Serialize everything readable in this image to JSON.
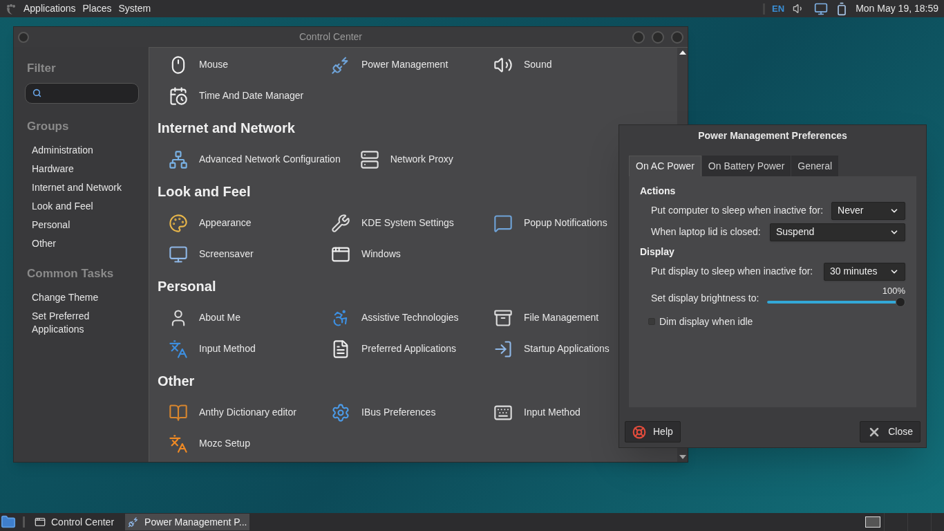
{
  "top_panel": {
    "menus": [
      "Applications",
      "Places",
      "System"
    ],
    "keyboard_layout": "EN",
    "clock": "Mon May 19, 18:59"
  },
  "control_center": {
    "title": "Control Center",
    "filter_heading": "Filter",
    "groups_heading": "Groups",
    "groups": [
      "Administration",
      "Hardware",
      "Internet and Network",
      "Look and Feel",
      "Personal",
      "Other"
    ],
    "common_tasks_heading": "Common Tasks",
    "common_tasks": [
      "Change Theme",
      "Set Preferred Applications"
    ],
    "sections": [
      {
        "items": [
          "Mouse",
          "Power Management",
          "Sound",
          "Time And Date Manager"
        ]
      },
      {
        "heading": "Internet and Network",
        "items": [
          "Advanced Network Configuration",
          "Network Proxy"
        ]
      },
      {
        "heading": "Look and Feel",
        "items": [
          "Appearance",
          "KDE System Settings",
          "Popup Notifications",
          "Screensaver",
          "Windows"
        ]
      },
      {
        "heading": "Personal",
        "items": [
          "About Me",
          "Assistive Technologies",
          "File Management",
          "Input Method",
          "Preferred Applications",
          "Startup Applications"
        ]
      },
      {
        "heading": "Other",
        "items": [
          "Anthy Dictionary editor",
          "IBus Preferences",
          "Input Method",
          "Mozc Setup"
        ]
      }
    ]
  },
  "power_dialog": {
    "title": "Power Management Preferences",
    "tabs": [
      {
        "label": "On AC Power",
        "selected": true
      },
      {
        "label": "On Battery Power",
        "selected": false
      },
      {
        "label": "General",
        "selected": false
      }
    ],
    "groups": [
      {
        "heading": "Actions",
        "rows": [
          {
            "kind": "dropdown",
            "label": "Put computer to sleep when inactive for:",
            "value": "Never"
          },
          {
            "kind": "dropdown",
            "label": "When laptop lid is closed:",
            "value": "Suspend"
          }
        ]
      },
      {
        "heading": "Display",
        "rows": [
          {
            "kind": "dropdown",
            "label": "Put display to sleep when inactive for:",
            "value": "30 minutes"
          },
          {
            "kind": "slider",
            "label": "Set display brightness to:",
            "reading": "100%",
            "level": 1.0
          },
          {
            "kind": "checkbox",
            "label": "Dim display when idle",
            "checked": false
          }
        ]
      }
    ],
    "buttons": [
      "Help",
      "Close"
    ]
  },
  "taskbar": {
    "tasks": [
      {
        "label": "Control Center",
        "selected": false
      },
      {
        "label": "Power Management P...",
        "selected": true
      }
    ]
  }
}
